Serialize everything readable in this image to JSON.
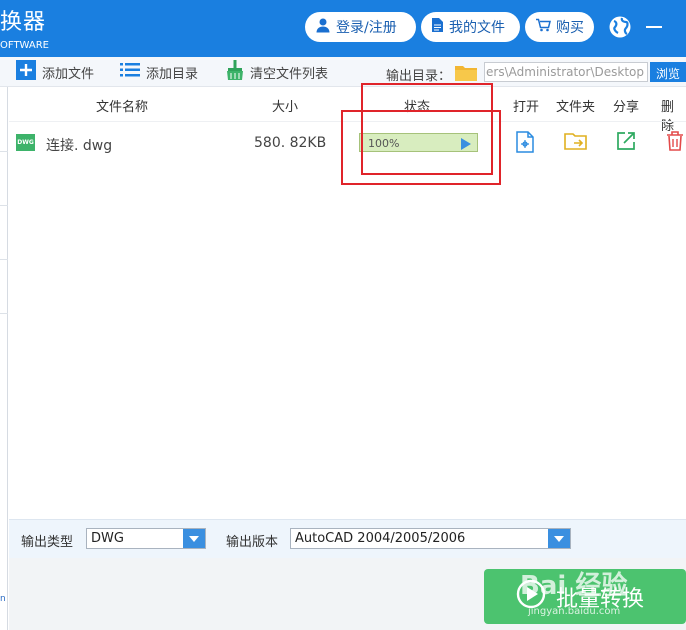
{
  "header": {
    "app_title": "换器",
    "app_subtitle": "OFTWARE",
    "login_label": "登录/注册",
    "my_files_label": "我的文件",
    "buy_label": "购买"
  },
  "toolbar": {
    "add_file_label": "添加文件",
    "add_dir_label": "添加目录",
    "clear_list_label": "清空文件列表",
    "output_dir_label": "输出目录：",
    "output_dir_value": "ers\\Administrator\\Desktop",
    "browse_label": "浏览"
  },
  "table": {
    "headers": {
      "name": "文件名称",
      "size": "大小",
      "status": "状态",
      "open": "打开",
      "folder": "文件夹",
      "share": "分享",
      "delete": "删除"
    },
    "rows": [
      {
        "icon_text": "DWG",
        "name": "连接. dwg",
        "size": "580. 82KB",
        "progress_text": "100%",
        "progress_value": 1.0
      }
    ]
  },
  "output": {
    "type_label": "输出类型",
    "type_value": "DWG",
    "version_label": "输出版本",
    "version_value": "AutoCAD 2004/2005/2006"
  },
  "footer": {
    "convert_label": "批量转换",
    "watermark_text": "Bai 经验",
    "watermark_url": "jingyan.baidu.com",
    "side_text": "n"
  },
  "colors": {
    "titlebar": "#1a7fe0",
    "accent": "#1a7fe0",
    "convert_button": "#4cc36f",
    "highlight": "#e0242a",
    "progress_fill": "#d8edbf"
  },
  "icons": {
    "login": "user-icon",
    "my_files": "document-icon",
    "buy": "cart-icon",
    "language": "globe-icon",
    "minimize": "minimize-icon",
    "add_file": "plus-icon",
    "add_dir": "list-icon",
    "clear_list": "broom-icon",
    "output_dir": "folder-icon",
    "open": "open-file-icon",
    "folder": "folder-open-icon",
    "share": "share-icon",
    "delete": "trash-icon",
    "convert": "play-circle-icon"
  }
}
